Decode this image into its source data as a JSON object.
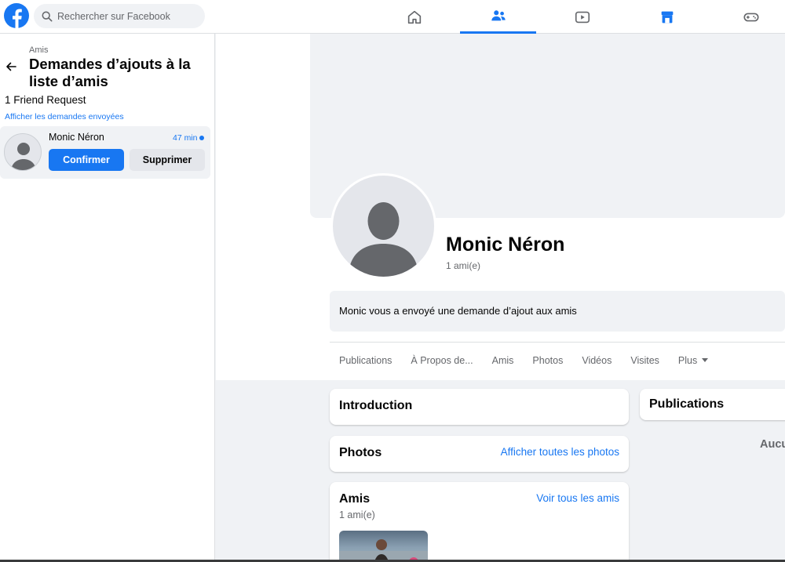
{
  "search": {
    "placeholder": "Rechercher sur Facebook"
  },
  "nav": {
    "items": [
      {
        "name": "home-icon",
        "active": false
      },
      {
        "name": "friends-icon",
        "active": true
      },
      {
        "name": "watch-icon",
        "active": false
      },
      {
        "name": "marketplace-icon",
        "active": false
      },
      {
        "name": "gaming-icon",
        "active": false
      }
    ]
  },
  "sidebar": {
    "breadcrumb": "Amis",
    "title": "Demandes d’ajouts à la liste d’amis",
    "request_count": "1 Friend Request",
    "sent_link": "Afficher les demandes envoyées",
    "request": {
      "name": "Monic Néron",
      "time": "47 min",
      "confirm_label": "Confirmer",
      "delete_label": "Supprimer"
    }
  },
  "profile": {
    "name": "Monic Néron",
    "friend_count": "1 ami(e)",
    "request_banner": "Monic vous a envoyé une demande d’ajout aux amis",
    "tabs": [
      "Publications",
      "À Propos de...",
      "Amis",
      "Photos",
      "Vidéos",
      "Visites",
      "Plus"
    ]
  },
  "cards": {
    "intro_title": "Introduction",
    "photos_title": "Photos",
    "photos_link": "Afficher toutes les photos",
    "friends_title": "Amis",
    "friends_link": "Voir tous les amis",
    "friends_count": "1 ami(e)",
    "publications_title": "Publications",
    "empty_text": "Aucu"
  },
  "colors": {
    "accent": "#1877f2",
    "background": "#f0f2f5"
  }
}
